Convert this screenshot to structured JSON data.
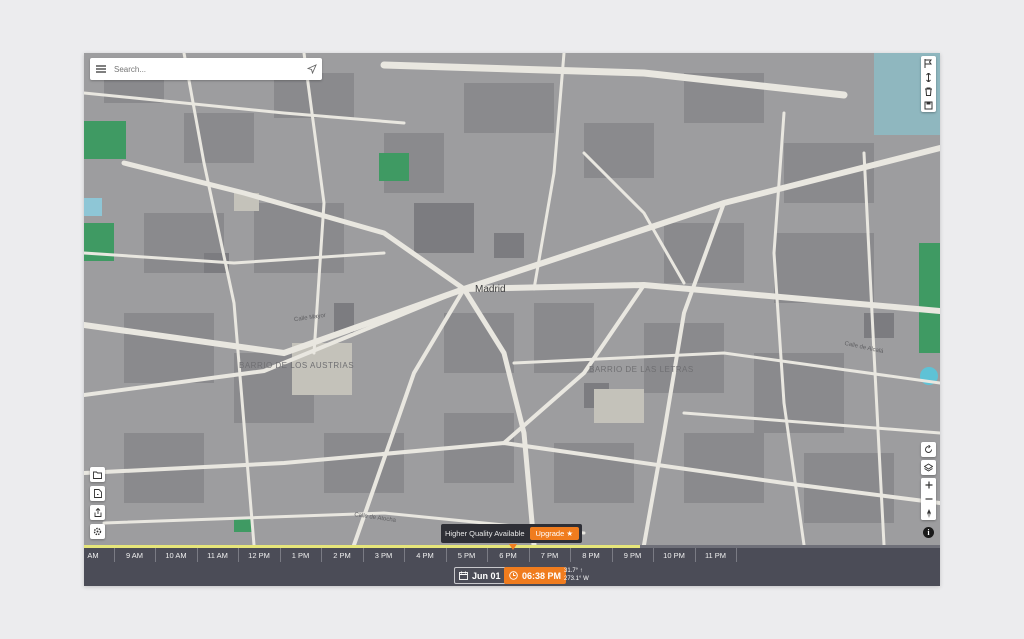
{
  "search": {
    "placeholder": "Search..."
  },
  "map": {
    "city_label": "Madrid",
    "district_labels": [
      "BARRIO DE LOS AUSTRIAS",
      "BARRIO DE LAS LETRAS"
    ],
    "street_labels": [
      "Calle Mayor",
      "Calle de Alcalá",
      "Calle de Atocha"
    ]
  },
  "banner": {
    "text": "Higher Quality Available",
    "upgrade_label": "Upgrade ★"
  },
  "timeline": {
    "hours": [
      "AM",
      "9 AM",
      "10 AM",
      "11 AM",
      "12 PM",
      "1 PM",
      "2 PM",
      "3 PM",
      "4 PM",
      "5 PM",
      "6 PM",
      "7 PM",
      "8 PM",
      "9 PM",
      "10 PM",
      "11 PM"
    ],
    "daylight_progress": 0.65
  },
  "footer": {
    "date": "Jun 01",
    "time": "06:38 PM",
    "elevation": "31.7° ↑",
    "azimuth": "273.1° W"
  },
  "colors": {
    "accent": "#f07c1e",
    "daylight": "#e6e67a",
    "panel": "#4b4c57",
    "park": "#3f9a63",
    "water": "#5ec2d6"
  }
}
